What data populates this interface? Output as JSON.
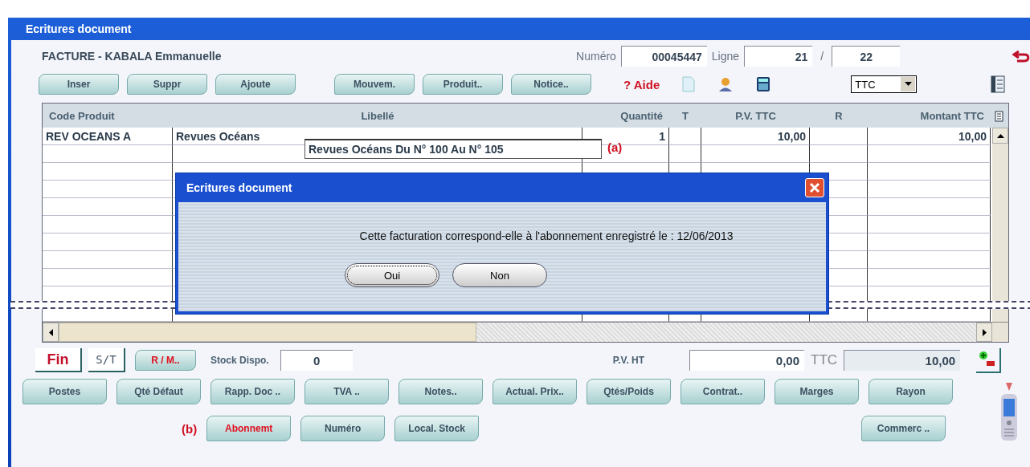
{
  "window": {
    "title": "Ecritures document"
  },
  "header": {
    "document": "FACTURE - KABALA Emmanuelle",
    "numero_label": "Numéro",
    "numero": "00045447",
    "ligne_label": "Ligne",
    "ligne": "21",
    "separator": "/",
    "ligne_total": "22"
  },
  "toolbar": {
    "buttons": [
      {
        "label": "Inser"
      },
      {
        "label": "Suppr"
      },
      {
        "label": "Ajoute"
      },
      {
        "label": "Mouvem."
      },
      {
        "label": "Produit.."
      },
      {
        "label": "Notice.."
      }
    ],
    "help": "? Aide",
    "price_mode": "TTC"
  },
  "table": {
    "columns": [
      {
        "label": "Code Produit"
      },
      {
        "label": "Libellé"
      },
      {
        "label": "Quantité"
      },
      {
        "label": "T"
      },
      {
        "label": "P.V. TTC"
      },
      {
        "label": "R"
      },
      {
        "label": "Montant TTC"
      }
    ],
    "rows": [
      {
        "cells": [
          "REV OCEANS A",
          "Revues Océans",
          "1",
          "",
          "10,00",
          "",
          "10,00"
        ]
      }
    ],
    "edit_field": "Revues Océans Du N° 100 Au N° 105",
    "edit_marker": "(a)"
  },
  "totals": {
    "fin": "Fin",
    "st": "S/T",
    "rm": "R / M..",
    "stock_label": "Stock Dispo.",
    "stock": "0",
    "pvht_label": "P.V. HT",
    "pvht": "0,00",
    "ttc_label": "TTC",
    "ttc": "10,00"
  },
  "action_rows": [
    [
      {
        "label": "Postes",
        "kind": "normal"
      },
      {
        "label": "Qté Défaut",
        "kind": "normal"
      },
      {
        "label": "Rapp. Doc ..",
        "kind": "normal"
      },
      {
        "label": "TVA ..",
        "kind": "normal"
      },
      {
        "label": "Notes..",
        "kind": "normal"
      },
      {
        "label": "Actual. Prix..",
        "kind": "normal"
      },
      {
        "label": "Qtés/Poids",
        "kind": "normal"
      },
      {
        "label": "Contrat..",
        "kind": "normal"
      },
      {
        "label": "Marges",
        "kind": "normal"
      },
      {
        "label": "Rayon",
        "kind": "normal"
      }
    ],
    [
      {
        "label": "(b)",
        "kind": "marker"
      },
      {
        "label": "Abonnemt",
        "kind": "alert"
      },
      {
        "label": "Numéro",
        "kind": "normal"
      },
      {
        "label": "Local. Stock",
        "kind": "normal"
      },
      {
        "label": "Commerc ..",
        "kind": "normal"
      }
    ]
  ],
  "dialog": {
    "title": "Ecritures document",
    "message": "Cette facturation correspond-elle à l'abonnement enregistré le : 12/06/2013",
    "buttons": [
      {
        "label": "Oui",
        "selected": true
      },
      {
        "label": "Non",
        "selected": false
      }
    ]
  }
}
